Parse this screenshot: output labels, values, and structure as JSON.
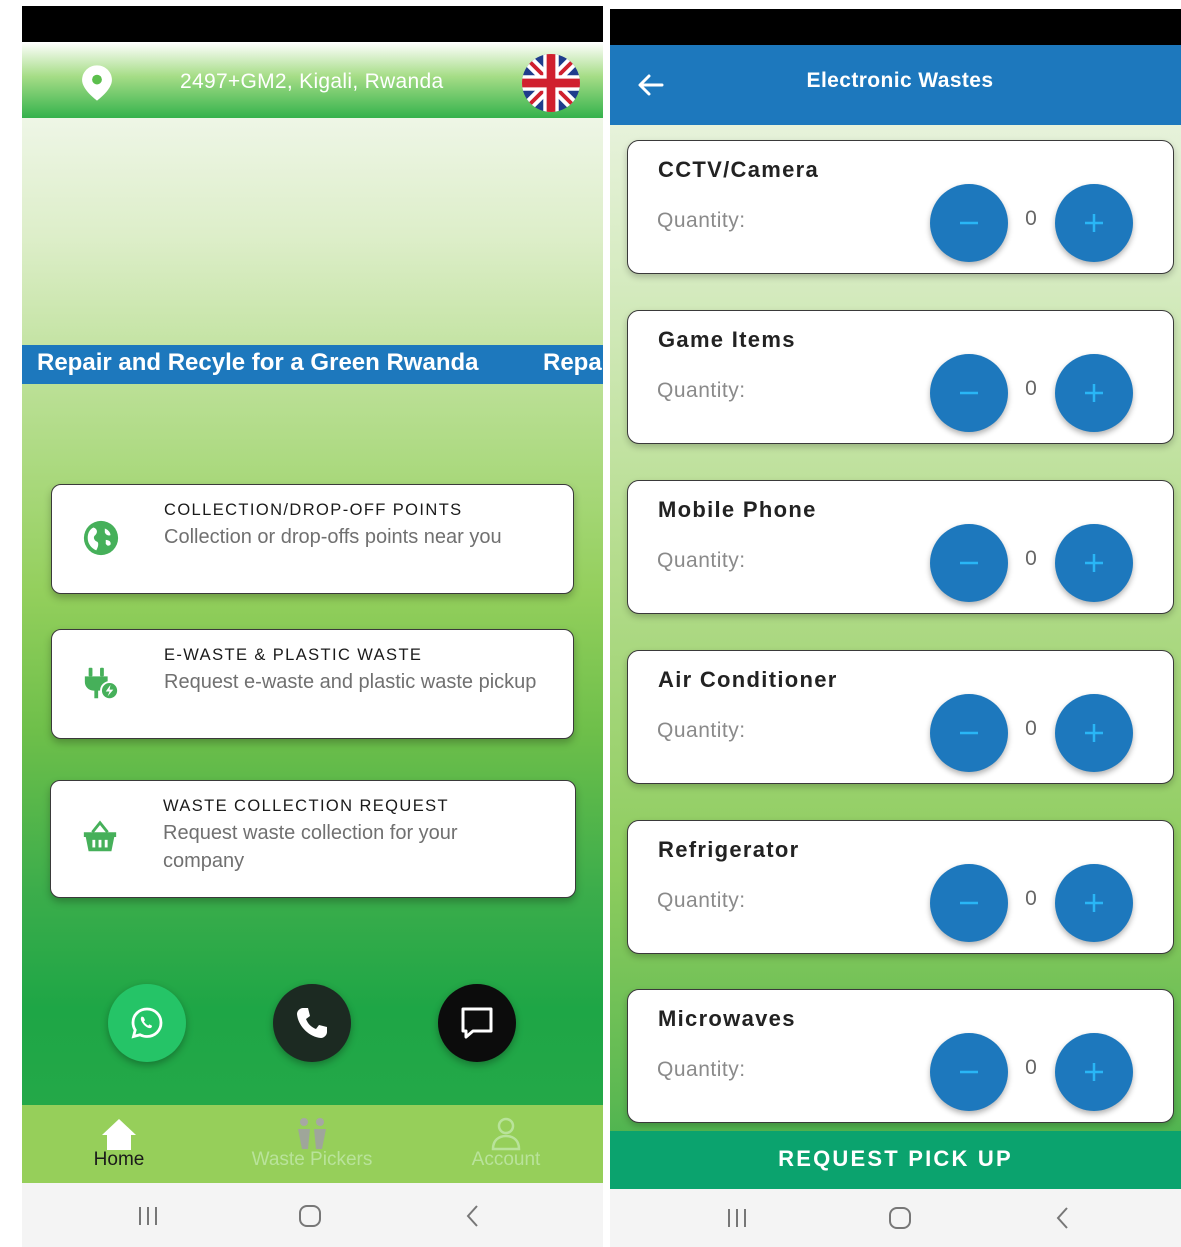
{
  "left_screen": {
    "location": "2497+GM2, Kigali, Rwanda",
    "marquee_text": "Repair and Recyle for a Green Rwanda",
    "marquee_repeat": "Repa",
    "cards": [
      {
        "title": "COLLECTION/DROP-OFF POINTS",
        "subtitle": "Collection or drop-offs points near you",
        "icon": "globe-icon"
      },
      {
        "title": "E-WASTE & PLASTIC WASTE",
        "subtitle": "Request e-waste and plastic waste pickup",
        "icon": "plug-icon"
      },
      {
        "title": "WASTE COLLECTION REQUEST",
        "subtitle": "Request waste collection for your company",
        "icon": "basket-icon"
      }
    ],
    "fabs": [
      {
        "name": "whatsapp",
        "icon": "whatsapp-icon",
        "color": "#25c467"
      },
      {
        "name": "call",
        "icon": "phone-icon",
        "color": "#1c2a22"
      },
      {
        "name": "chat",
        "icon": "chat-icon",
        "color": "#0c0c0c"
      }
    ],
    "bottom_nav": [
      {
        "label": "Home",
        "icon": "home-icon",
        "active": true
      },
      {
        "label": "Waste Pickers",
        "icon": "waste-pickers-icon",
        "active": false
      },
      {
        "label": "Account",
        "icon": "account-icon",
        "active": false
      }
    ]
  },
  "right_screen": {
    "title": "Electronic Wastes",
    "quantity_label": "Quantity:",
    "items": [
      {
        "name": "CCTV/Camera",
        "quantity": "0"
      },
      {
        "name": "Game Items",
        "quantity": "0"
      },
      {
        "name": "Mobile Phone",
        "quantity": "0"
      },
      {
        "name": "Air Conditioner",
        "quantity": "0"
      },
      {
        "name": "Refrigerator",
        "quantity": "0"
      },
      {
        "name": "Microwaves",
        "quantity": "0"
      }
    ],
    "request_button": "REQUEST PICK UP"
  },
  "colors": {
    "primary_blue": "#1d78bd",
    "request_green": "#0ba36e",
    "nav_green": "#96cf5a"
  }
}
